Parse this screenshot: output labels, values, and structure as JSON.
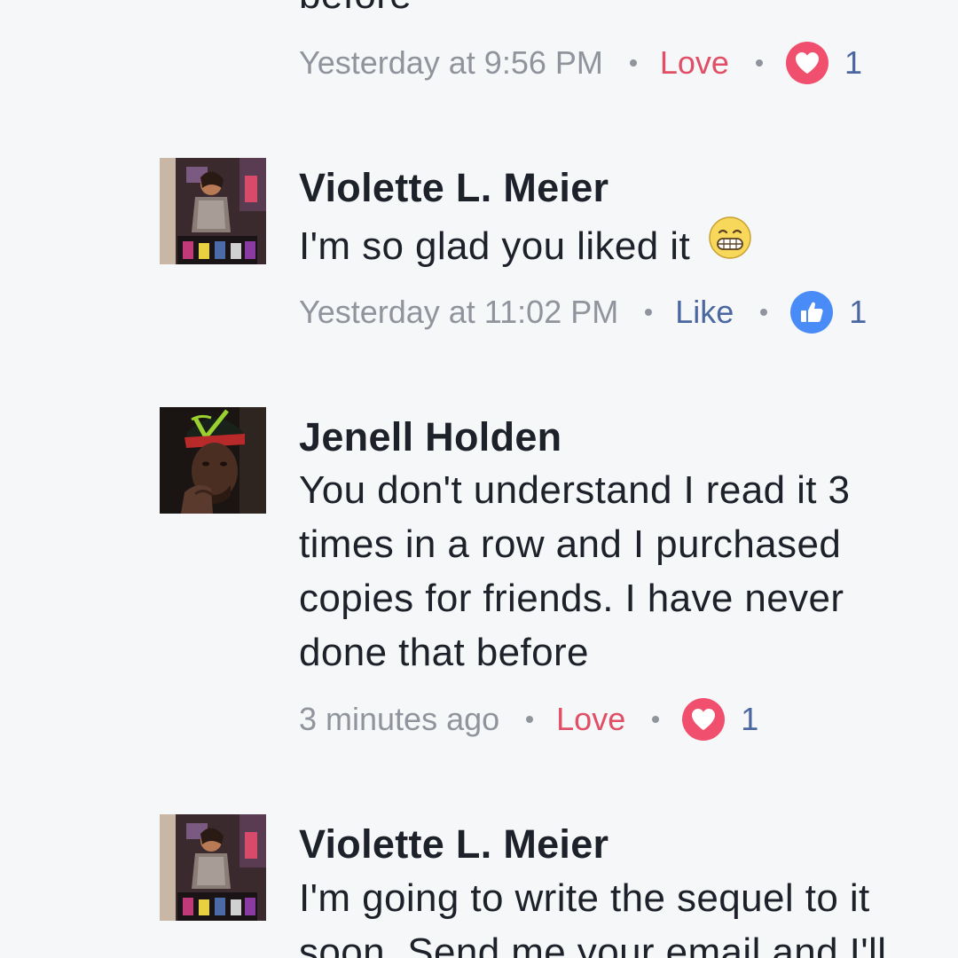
{
  "comments": [
    {
      "author": "",
      "lines": [
        "before"
      ],
      "time": "Yesterday at 9:56 PM",
      "reaction_label": "Love",
      "reaction_icon": "heart-icon",
      "reaction_count": "1"
    },
    {
      "author": "Violette L. Meier",
      "lines": [
        "I'm so glad you liked it"
      ],
      "emoji": "grinning-face-emoji",
      "time": "Yesterday at 11:02 PM",
      "reaction_label": "Like",
      "reaction_icon": "thumbs-up-icon",
      "reaction_count": "1"
    },
    {
      "author": "Jenell Holden",
      "lines": [
        "You don't understand I read it 3",
        "times in a row and I purchased",
        "copies for friends. I have never",
        "done that before"
      ],
      "time": "3 minutes ago",
      "reaction_label": "Love",
      "reaction_icon": "heart-icon",
      "reaction_count": "1"
    },
    {
      "author": "Violette L. Meier",
      "lines": [
        "I'm going to write the sequel to it",
        "soon. Send me your email and I'll"
      ]
    }
  ],
  "colors": {
    "background": "#f6f7f9",
    "text": "#1d2129",
    "meta": "#90949c",
    "love": "#e04f66",
    "like_text": "#4b67a1",
    "like_badge": "#4a8cf7",
    "love_badge": "#f0506e"
  }
}
